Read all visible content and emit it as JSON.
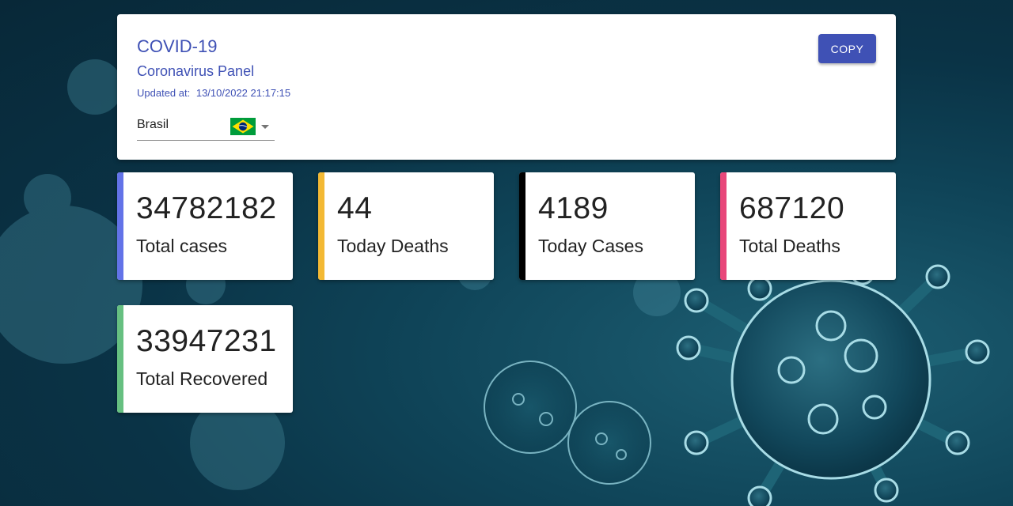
{
  "header": {
    "title": "COVID-19",
    "subtitle": "Coronavirus Panel",
    "updated_label": "Updated at:",
    "updated_value": "13/10/2022 21:17:15",
    "copy_label": "COPY",
    "country": {
      "selected": "Brasil",
      "flag_icon": "brazil-flag-icon"
    }
  },
  "stats": [
    {
      "value": "34782182",
      "label": "Total cases",
      "color": "#6373e8"
    },
    {
      "value": "44",
      "label": "Today Deaths",
      "color": "#f3b934"
    },
    {
      "value": "4189",
      "label": "Today Cases",
      "color": "#000000"
    },
    {
      "value": "687120",
      "label": "Total Deaths",
      "color": "#e8477a"
    },
    {
      "value": "33947231",
      "label": "Total Recovered",
      "color": "#66c081"
    }
  ],
  "colors": {
    "accent": "#3f51b5",
    "background": "#0a3346"
  }
}
